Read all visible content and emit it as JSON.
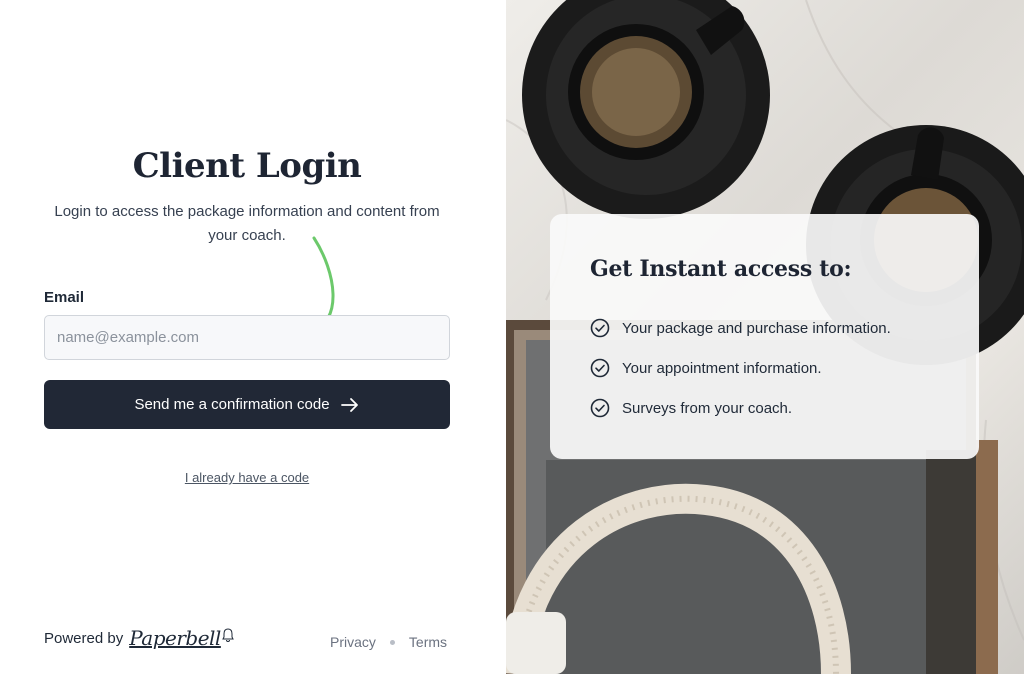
{
  "login": {
    "title": "Client Login",
    "subtitle": "Login to access the package information and content from your coach.",
    "email_label": "Email",
    "email_placeholder": "name@example.com",
    "email_value": "",
    "send_button_label": "Send me a confirmation code",
    "have_code_link": "I already have a code"
  },
  "footer": {
    "powered_by": "Powered by",
    "brand": "Paperbell",
    "privacy": "Privacy",
    "terms": "Terms"
  },
  "access_card": {
    "title": "Get Instant access to:",
    "items": [
      "Your package and purchase information.",
      "Your appointment information.",
      "Surveys from your coach."
    ]
  },
  "colors": {
    "primary_button": "#212836",
    "annotation_arrow": "#6cc96b",
    "heading": "#1e2533"
  },
  "icons": {
    "button_arrow": "arrow-right-icon",
    "check": "check-circle-icon",
    "brand_bell": "bell-icon"
  }
}
